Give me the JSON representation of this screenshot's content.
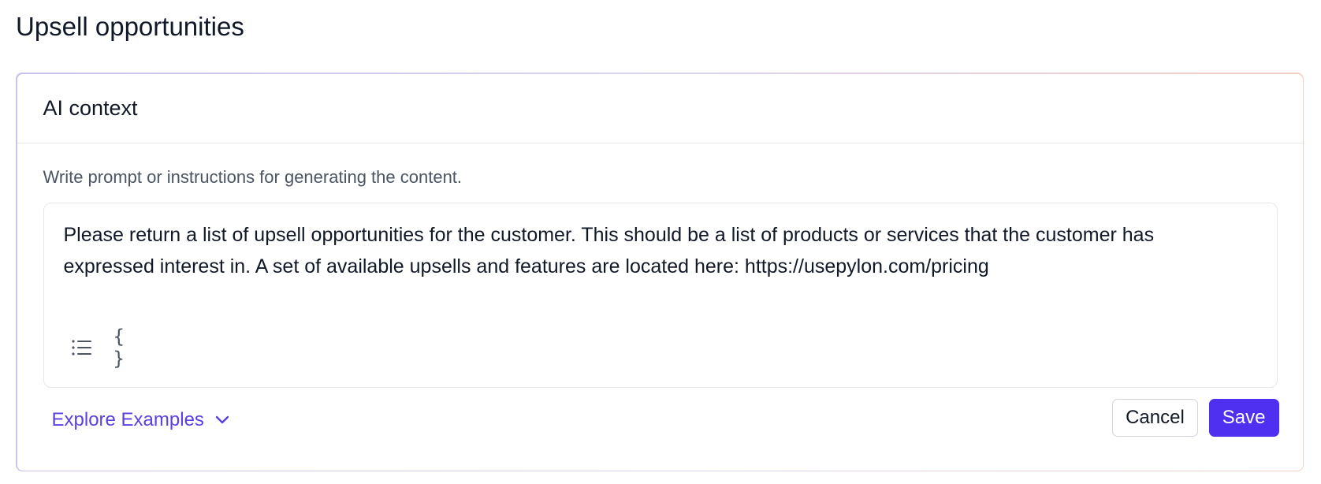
{
  "page": {
    "title": "Upsell opportunities"
  },
  "card": {
    "header_title": "AI context",
    "helper_text": "Write prompt or instructions for generating the content.",
    "editor": {
      "value": "Please return a list of upsell opportunities for the customer. This should be a list of products or services that the customer has expressed interest in. A set of available upsells and features are located here: https://usepylon.com/pricing",
      "toolbar": {
        "list_icon": "bulleted-list-icon",
        "variable_icon": "curly-braces-icon",
        "variable_glyph": "{ }"
      }
    },
    "explore_label": "Explore Examples",
    "cancel_label": "Cancel",
    "save_label": "Save"
  },
  "colors": {
    "accent": "#4f2ff0",
    "link": "#5b3fe0",
    "text": "#111827",
    "muted": "#4b5563",
    "border": "#e5e7eb"
  }
}
